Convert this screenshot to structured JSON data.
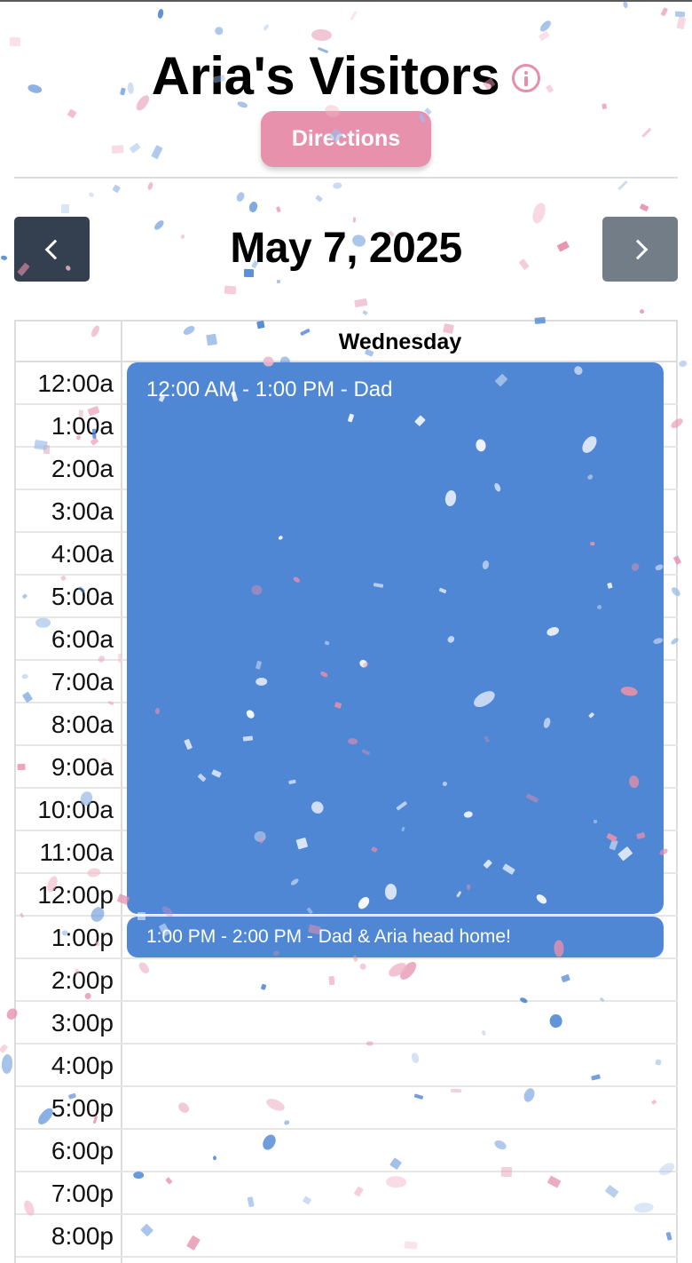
{
  "header": {
    "title": "Aria's Visitors",
    "info_icon": "info-circle-icon",
    "directions_label": "Directions"
  },
  "nav": {
    "date": "May 7, 2025",
    "prev_icon": "chevron-left-icon",
    "next_icon": "chevron-right-icon"
  },
  "calendar": {
    "day": "Wednesday",
    "hours": [
      "12:00a",
      "1:00a",
      "2:00a",
      "3:00a",
      "4:00a",
      "5:00a",
      "6:00a",
      "7:00a",
      "8:00a",
      "9:00a",
      "10:00a",
      "11:00a",
      "12:00p",
      "1:00p",
      "2:00p",
      "3:00p",
      "4:00p",
      "5:00p",
      "6:00p",
      "7:00p",
      "8:00p"
    ],
    "events": [
      {
        "label": "12:00 AM - 1:00 PM - Dad"
      },
      {
        "label": "1:00 PM - 2:00 PM - Dad & Aria head home!"
      }
    ]
  },
  "colors": {
    "accent_pink": "#e891ad",
    "event_blue": "#4f87d5",
    "nav_dark": "#343f4f",
    "nav_gray": "#737d87"
  }
}
